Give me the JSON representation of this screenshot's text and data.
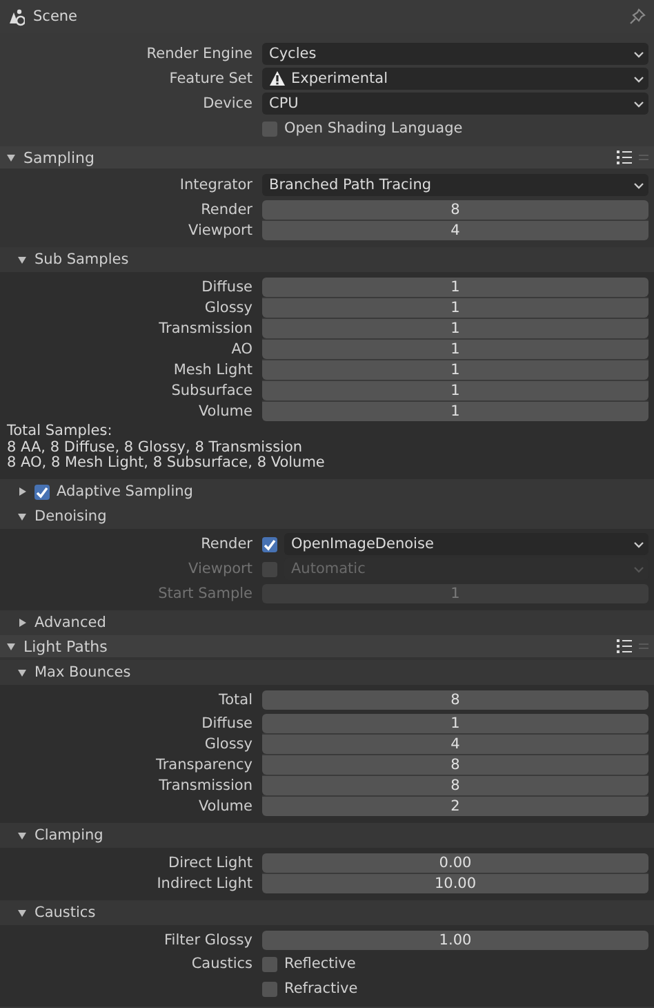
{
  "title_bar": {
    "title": "Scene"
  },
  "items": [
    {
      "kind": "dropdown",
      "label": "Render Engine",
      "value": "Cycles",
      "warning": false
    },
    {
      "kind": "dropdown",
      "label": "Feature Set",
      "value": "Experimental",
      "warning": true
    },
    {
      "kind": "dropdown",
      "label": "Device",
      "value": "CPU",
      "warning": false
    },
    {
      "kind": "checkbox",
      "text": "Open Shading Language",
      "checked": false
    },
    {
      "kind": "panel",
      "title": "Sampling",
      "expanded": true,
      "children": [
        {
          "kind": "dropdown",
          "label": "Integrator",
          "value": "Branched Path Tracing",
          "warning": false
        },
        {
          "kind": "numbers",
          "fields": [
            {
              "label": "Render",
              "value": "8"
            },
            {
              "label": "Viewport",
              "value": "4"
            }
          ]
        },
        {
          "kind": "subpanel",
          "title": "Sub Samples",
          "expanded": true,
          "children": [
            {
              "kind": "numbers",
              "fields": [
                {
                  "label": "Diffuse",
                  "value": "1"
                },
                {
                  "label": "Glossy",
                  "value": "1"
                },
                {
                  "label": "Transmission",
                  "value": "1"
                },
                {
                  "label": "AO",
                  "value": "1"
                },
                {
                  "label": "Mesh Light",
                  "value": "1"
                },
                {
                  "label": "Subsurface",
                  "value": "1"
                },
                {
                  "label": "Volume",
                  "value": "1"
                }
              ]
            },
            {
              "kind": "text",
              "lines": [
                "Total Samples:",
                "8 AA, 8 Diffuse, 8 Glossy, 8 Transmission",
                "8 AO, 8 Mesh Light, 8 Subsurface, 8 Volume"
              ]
            }
          ]
        },
        {
          "kind": "subpanel",
          "title": "Adaptive Sampling",
          "expanded": false,
          "checked": true
        },
        {
          "kind": "subpanel",
          "title": "Denoising",
          "expanded": true,
          "children": [
            {
              "kind": "check-dropdown",
              "label": "Render",
              "checked": true,
              "value": "OpenImageDenoise",
              "disabled": false
            },
            {
              "kind": "check-dropdown",
              "label": "Viewport",
              "checked": false,
              "value": "Automatic",
              "disabled": true
            },
            {
              "kind": "numbers",
              "disabled": true,
              "fields": [
                {
                  "label": "Start Sample",
                  "value": "1"
                }
              ]
            }
          ]
        },
        {
          "kind": "subpanel",
          "title": "Advanced",
          "expanded": false
        }
      ]
    },
    {
      "kind": "panel",
      "title": "Light Paths",
      "expanded": true,
      "children": [
        {
          "kind": "subpanel",
          "title": "Max Bounces",
          "expanded": true,
          "children": [
            {
              "kind": "numbers",
              "fields": [
                {
                  "label": "Total",
                  "value": "8"
                }
              ]
            },
            {
              "kind": "numbers",
              "fields": [
                {
                  "label": "Diffuse",
                  "value": "1"
                },
                {
                  "label": "Glossy",
                  "value": "4"
                },
                {
                  "label": "Transparency",
                  "value": "8"
                },
                {
                  "label": "Transmission",
                  "value": "8"
                },
                {
                  "label": "Volume",
                  "value": "2"
                }
              ]
            }
          ]
        },
        {
          "kind": "subpanel",
          "title": "Clamping",
          "expanded": true,
          "children": [
            {
              "kind": "numbers",
              "fields": [
                {
                  "label": "Direct Light",
                  "value": "0.00"
                },
                {
                  "label": "Indirect Light",
                  "value": "10.00"
                }
              ]
            }
          ]
        },
        {
          "kind": "subpanel",
          "title": "Caustics",
          "expanded": true,
          "children": [
            {
              "kind": "numbers",
              "fields": [
                {
                  "label": "Filter Glossy",
                  "value": "1.00"
                }
              ]
            },
            {
              "kind": "checkbox",
              "label": "Caustics",
              "text": "Reflective",
              "checked": false
            },
            {
              "kind": "checkbox",
              "text": "Refractive",
              "checked": false
            }
          ]
        }
      ]
    }
  ]
}
